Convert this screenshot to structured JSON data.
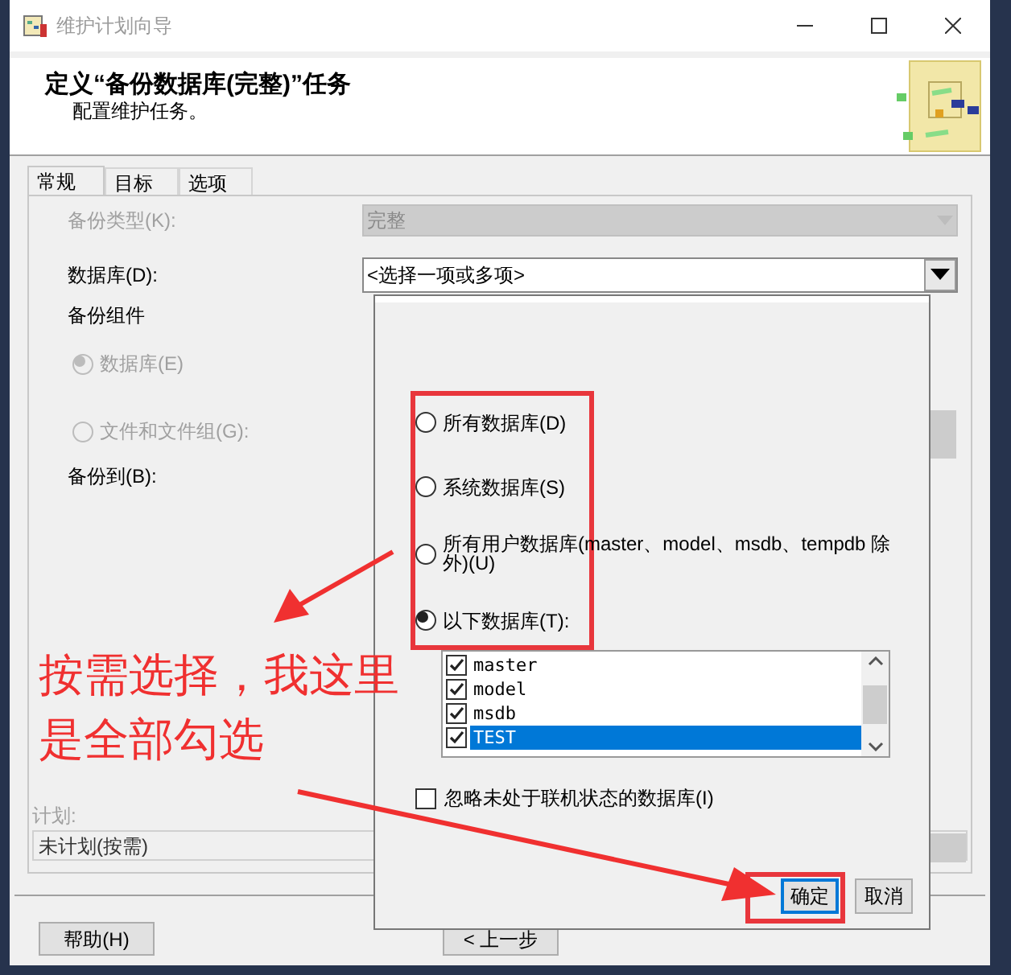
{
  "window": {
    "title": "维护计划向导"
  },
  "header": {
    "title": "定义“备份数据库(完整)”任务",
    "subtitle": "配置维护任务。"
  },
  "tabs": [
    {
      "label": "常规",
      "selected": true
    },
    {
      "label": "目标",
      "selected": false
    },
    {
      "label": "选项",
      "selected": false
    }
  ],
  "backup_type": {
    "label": "备份类型(K):",
    "value": "完整",
    "disabled": true
  },
  "database": {
    "label": "数据库(D):",
    "value": "<选择一项或多项>"
  },
  "backup_component": {
    "label": "备份组件",
    "options": [
      {
        "label": "数据库(E)",
        "selected": true,
        "disabled": true
      },
      {
        "label": "文件和文件组(G):",
        "selected": false,
        "disabled": true
      }
    ]
  },
  "backup_to": {
    "label": "备份到(B):"
  },
  "schedule": {
    "label": "计划:",
    "value": "未计划(按需)",
    "disabled": true
  },
  "buttons": [
    {
      "label": "帮助(H)"
    },
    {
      "label": "< 上一步"
    }
  ],
  "database_popup": {
    "options": [
      {
        "label": "所有数据库(D)",
        "selected": false
      },
      {
        "label": "系统数据库(S)",
        "selected": false
      },
      {
        "label": "所有用户数据库(master、model、msdb、tempdb 除外)(U)",
        "selected": false
      },
      {
        "label": "以下数据库(T):",
        "selected": true
      }
    ],
    "databases": [
      {
        "name": "master",
        "checked": true,
        "selected": false
      },
      {
        "name": "model",
        "checked": true,
        "selected": false
      },
      {
        "name": "msdb",
        "checked": true,
        "selected": false
      },
      {
        "name": "TEST",
        "checked": true,
        "selected": true
      }
    ],
    "ignore_offline": {
      "label": "忽略未处于联机状态的数据库(I)",
      "checked": false
    },
    "buttons": [
      {
        "label": "确定",
        "focused": true
      },
      {
        "label": "取消",
        "focused": false
      }
    ]
  },
  "annotation": {
    "lines": [
      "按需选择，我这里",
      "是全部勾选"
    ]
  }
}
